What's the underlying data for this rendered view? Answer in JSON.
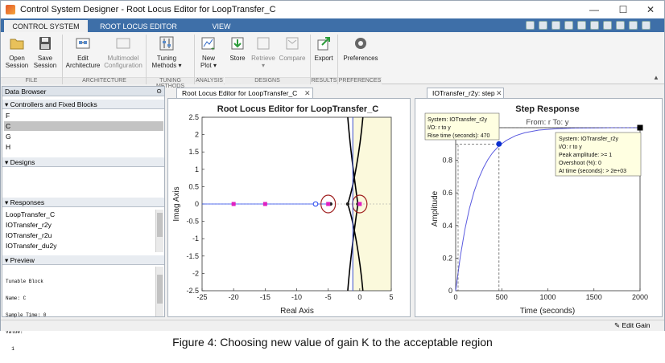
{
  "window": {
    "title": "Control System Designer - Root Locus Editor for LoopTransfer_C",
    "minimize_glyph": "—",
    "maximize_glyph": "☐",
    "close_glyph": "✕"
  },
  "tabs": [
    {
      "label": "CONTROL SYSTEM"
    },
    {
      "label": "ROOT LOCUS EDITOR"
    },
    {
      "label": "VIEW"
    }
  ],
  "ribbon": {
    "buttons": {
      "open_session": "Open\nSession",
      "save_session": "Save\nSession",
      "edit_architecture": "Edit\nArchitecture",
      "multimodel": "Multimodel\nConfiguration",
      "tuning_methods": "Tuning\nMethods ▾",
      "new_plot": "New\nPlot ▾",
      "store": "Store",
      "retrieve": "Retrieve\n▾",
      "compare": "Compare",
      "export": "Export",
      "preferences": "Preferences"
    },
    "groups": {
      "file": "FILE",
      "architecture": "ARCHITECTURE",
      "tuning_methods": "TUNING METHODS",
      "analysis": "ANALYSIS",
      "designs": "DESIGNS",
      "results": "RESULTS",
      "preferences": "PREFERENCES"
    }
  },
  "data_browser": {
    "title": "Data Browser",
    "controllers": {
      "header": "▾ Controllers and Fixed Blocks",
      "items": [
        "F",
        "C",
        "G",
        "H"
      ]
    },
    "designs": {
      "header": "▾ Designs"
    },
    "responses": {
      "header": "▾ Responses",
      "items": [
        "LoopTransfer_C",
        "IOTransfer_r2y",
        "IOTransfer_r2u",
        "IOTransfer_du2y"
      ]
    },
    "preview": {
      "header": "▾ Preview",
      "lines": [
        "Tunable Block",
        "Name: C",
        "Sample Time: 0",
        "Value:",
        "  1"
      ]
    }
  },
  "root_locus": {
    "tab_label": "Root Locus Editor for LoopTransfer_C",
    "close_glyph": "✕"
  },
  "step_view": {
    "tab_label": "IOTransfer_r2y: step",
    "close_glyph": "✕"
  },
  "datatip_rise": {
    "line1": "System: IOTransfer_r2y",
    "line2": "I/O: r to y",
    "line3": "Rise time (seconds): 470"
  },
  "datatip_peak": {
    "line1": "System: IOTransfer_r2y",
    "line2": "I/O: r to y",
    "line3": "Peak amplitude: >= 1",
    "line4": "Overshoot (%): 0",
    "line5": "At time (seconds): > 2e+03"
  },
  "statusbar": {
    "edit_gain": "Edit Gain"
  },
  "caption": "Figure 4: Choosing new value of gain K to the acceptable region",
  "chart_data": [
    {
      "type": "scatter",
      "title": "Root Locus Editor for LoopTransfer_C",
      "xlabel": "Real Axis",
      "ylabel": "Imag Axis",
      "xlim": [
        -25,
        5
      ],
      "ylim": [
        -2.5,
        2.5
      ],
      "xticks": [
        "-25",
        "-20",
        "-15",
        "-10",
        "-5",
        "0",
        "5"
      ],
      "yticks": [
        "2.5",
        "2",
        "1.5",
        "1",
        "0.5",
        "0",
        "-0.5",
        "-1",
        "-1.5",
        "-2",
        "-2.5"
      ],
      "acceptable_region": [
        -1.1,
        5
      ],
      "closed_loop_poles": [
        [
          -20,
          0
        ],
        [
          -15,
          0
        ],
        [
          -5,
          0
        ],
        [
          0,
          0
        ]
      ],
      "open_loop_zero": [
        [
          -7,
          0
        ]
      ],
      "open_loop_poles": [
        [
          -4.6,
          0
        ],
        [
          -1.9,
          0
        ],
        [
          -0.3,
          0
        ]
      ],
      "circled_points": [
        [
          -5,
          0
        ],
        [
          0,
          0
        ]
      ],
      "colors": {
        "closed_loop": "#e020c0",
        "zero": "#2244ee",
        "locus": "#000000",
        "region": "#fbf9dc",
        "circle": "#a02020"
      }
    },
    {
      "type": "line",
      "title": "Step Response",
      "subtitle": "From: r  To: y",
      "xlabel": "Time (seconds)",
      "ylabel": "Amplitude",
      "xlim": [
        0,
        2000
      ],
      "ylim": [
        0,
        1
      ],
      "xticks": [
        "0",
        "500",
        "1000",
        "1500",
        "2000"
      ],
      "yticks": [
        "0",
        "0.2",
        "0.4",
        "0.6",
        "0.8"
      ],
      "series": [
        {
          "x": [
            0,
            50,
            100,
            150,
            200,
            250,
            300,
            350,
            400,
            470,
            550,
            650,
            750,
            900,
            1100,
            1300,
            1500,
            1700,
            2000
          ],
          "y": [
            0,
            0.209,
            0.376,
            0.506,
            0.608,
            0.689,
            0.753,
            0.805,
            0.846,
            0.889,
            0.922,
            0.951,
            0.969,
            0.985,
            0.994,
            0.998,
            0.999,
            1.0,
            1.0
          ]
        }
      ],
      "rise_time_marker": {
        "x": 470,
        "y": 0.9
      },
      "peak_marker": {
        "x": 2000,
        "y": 1.0
      },
      "colors": {
        "line": "#5a5adf",
        "marker": "#0b2fd0"
      }
    }
  ]
}
